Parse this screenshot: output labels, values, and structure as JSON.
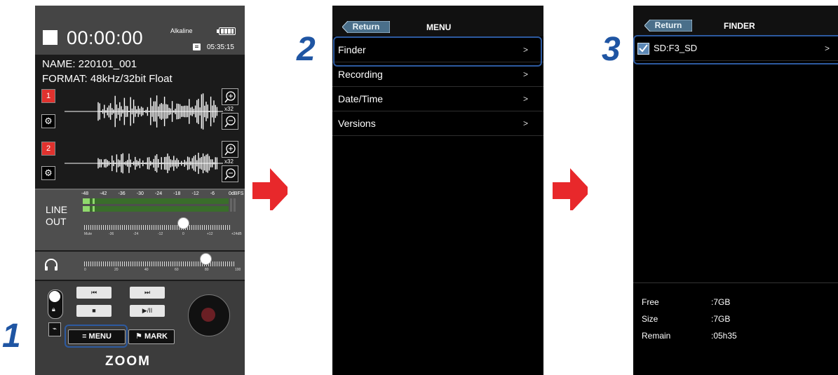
{
  "recorder": {
    "timecode": "00:00:00",
    "battery_label": "Alkaline",
    "remain_time": "05:35:15",
    "name": "NAME:  220101_001",
    "format": "FORMAT:  48kHz/32bit Float",
    "track1": "1",
    "track2": "2",
    "zoom_x": "x32",
    "meter_scale": [
      "-48",
      "-42",
      "-36",
      "-30",
      "-24",
      "-18",
      "-12",
      "-6",
      "0dBFS"
    ],
    "line_out": [
      "LINE",
      "OUT"
    ],
    "line_ticks": [
      "Mute",
      "-36",
      "-24",
      "-12",
      "0",
      "+12",
      "+24dB"
    ],
    "line_out_level_db": 0,
    "hp_ticks": [
      "0",
      "20",
      "40",
      "60",
      "80",
      "100"
    ],
    "hp_level": 80,
    "transport": {
      "rew": "⏮",
      "ff": "⏭",
      "stop": "■",
      "play": "▶/II"
    },
    "menu_label": "MENU",
    "mark_label": "MARK",
    "logo": "ZOOM"
  },
  "steps": [
    "1",
    "2",
    "3"
  ],
  "menu_screen": {
    "return_label": "Return",
    "title": "MENU",
    "items": [
      "Finder",
      "Recording",
      "Date/Time",
      "Versions"
    ]
  },
  "finder_screen": {
    "return_label": "Return",
    "title": "FINDER",
    "card": "SD:F3_SD",
    "free_label": "Free",
    "free_value": ":7GB",
    "size_label": "Size",
    "size_value": ":7GB",
    "remain_label": "Remain",
    "remain_value": ":05h35"
  },
  "colors": {
    "accent_blue": "#2d5aa0",
    "arrow_red": "#e8282b",
    "track_red": "#e0322e"
  }
}
